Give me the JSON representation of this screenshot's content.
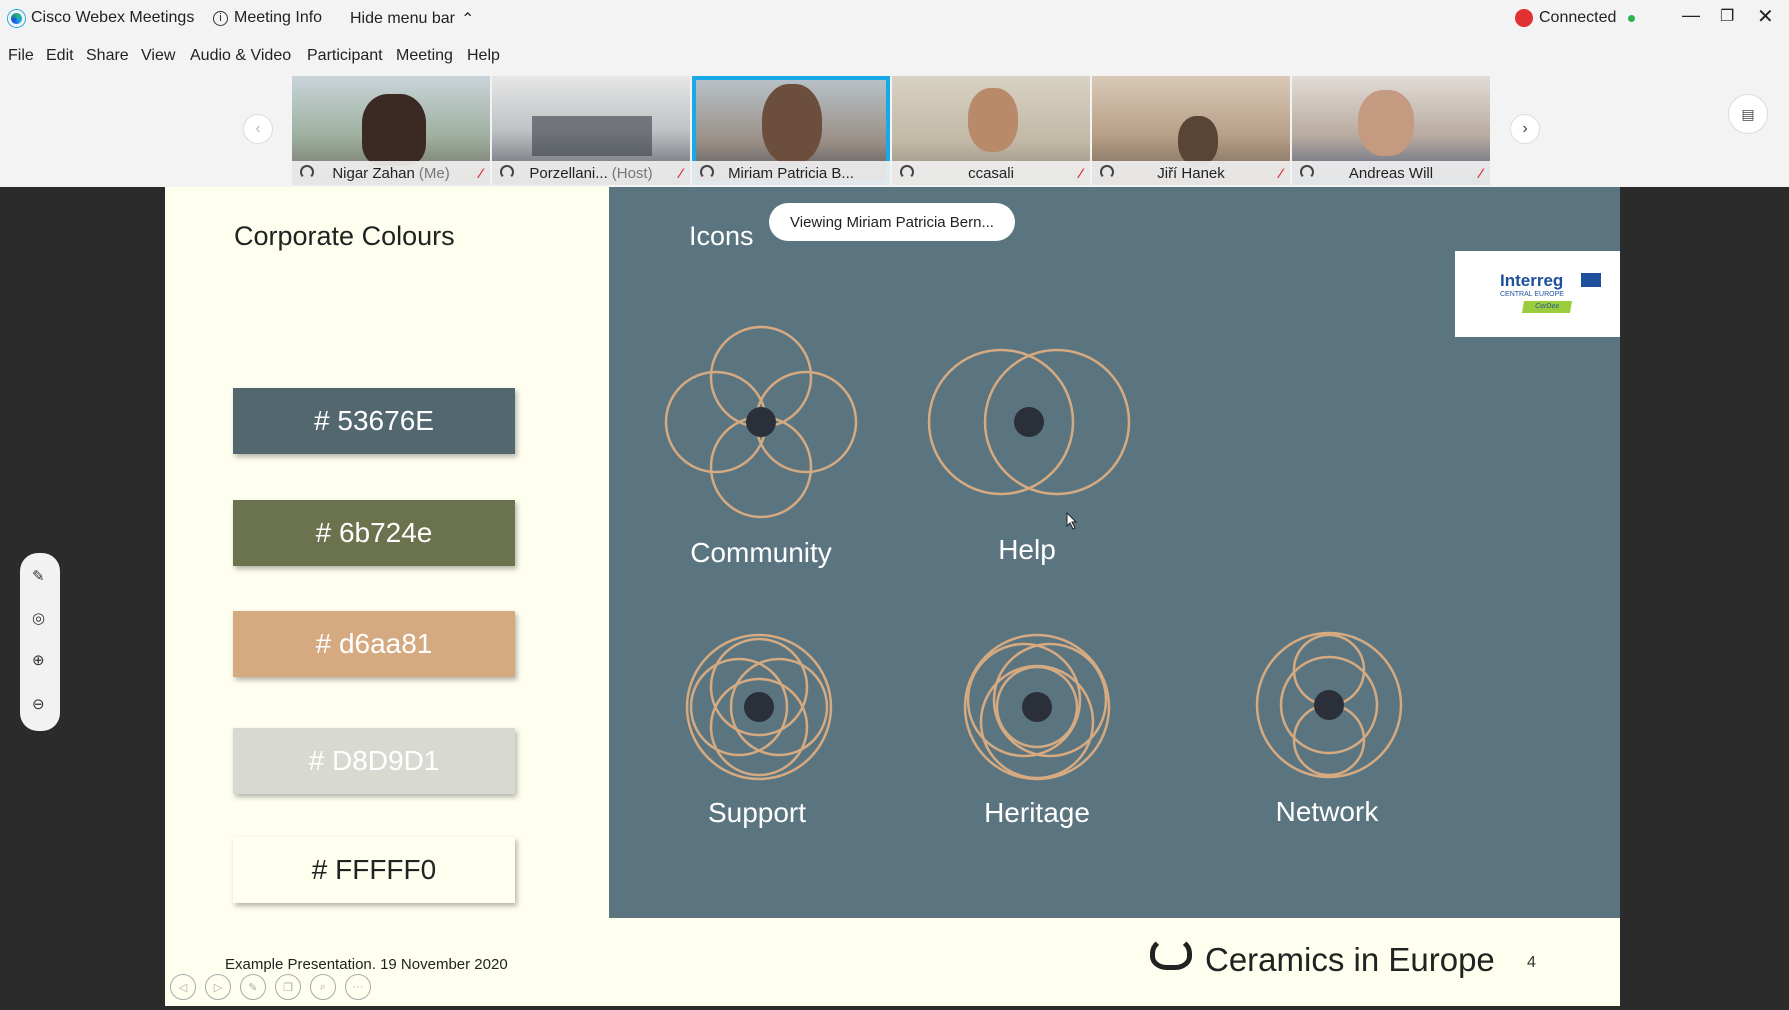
{
  "titlebar": {
    "app_title": "Cisco Webex Meetings",
    "meeting_info": "Meeting Info",
    "hide_menu": "Hide menu bar",
    "connected": "Connected"
  },
  "menu": [
    "File",
    "Edit",
    "Share",
    "View",
    "Audio & Video",
    "Participant",
    "Meeting",
    "Help"
  ],
  "participants": [
    {
      "name": "Nigar Zahan",
      "role": "(Me)"
    },
    {
      "name": "Porzellani...",
      "role": "(Host)"
    },
    {
      "name": "Miriam Patricia B...",
      "role": ""
    },
    {
      "name": "ccasali",
      "role": ""
    },
    {
      "name": "Jiří Hanek",
      "role": ""
    },
    {
      "name": "Andreas Will",
      "role": ""
    }
  ],
  "viewing_banner": "Viewing Miriam Patricia Bern...",
  "slide": {
    "left_title": "Corporate Colours",
    "right_title": "Icons",
    "swatches": [
      {
        "label": "# 53676E",
        "bg": "#53676E",
        "fg": "#ffffff"
      },
      {
        "label": "# 6b724e",
        "bg": "#6b724e",
        "fg": "#ffffff"
      },
      {
        "label": "# d6aa81",
        "bg": "#d6aa81",
        "fg": "#ffffff"
      },
      {
        "label": "# D8D9D1",
        "bg": "#D8D9D1",
        "fg": "#ffffff"
      },
      {
        "label": "# FFFFF0",
        "bg": "#FFFFF0",
        "fg": "#222222"
      }
    ],
    "icons": {
      "community": "Community",
      "help": "Help",
      "support": "Support",
      "heritage": "Heritage",
      "network": "Network"
    },
    "logo": {
      "line1": "Interreg",
      "line2": "CENTRAL EUROPE",
      "line3": "CerDee"
    },
    "footer_text": "Example Presentation. 19 November 2020",
    "brand": "Ceramics in Europe",
    "page_number": "4"
  },
  "colors": {
    "accent": "#19a9e6",
    "icon_stroke": "#d6aa81",
    "icon_dot": "#2a2f3a"
  }
}
